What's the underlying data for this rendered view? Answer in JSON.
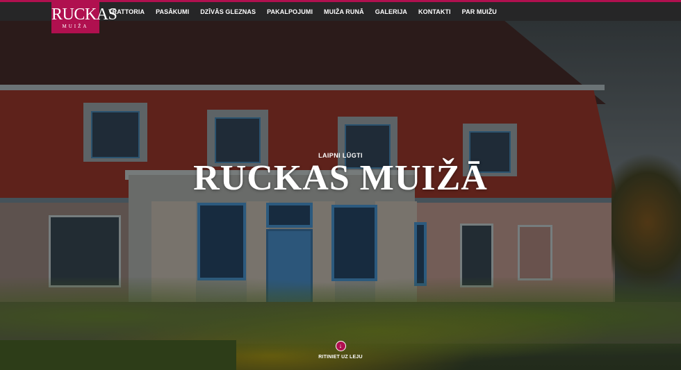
{
  "brand": {
    "name": "RUCKAS",
    "sub": "MUIŽA",
    "color": "#b0104f"
  },
  "nav": {
    "items": [
      {
        "label": "TRATTORIA"
      },
      {
        "label": "PASĀKUMI"
      },
      {
        "label": "DZĪVĀS GLEZNAS"
      },
      {
        "label": "PAKALPOJUMI"
      },
      {
        "label": "MUIŽA RUNĀ"
      },
      {
        "label": "GALERIJA"
      },
      {
        "label": "KONTAKTI"
      },
      {
        "label": "PAR MUIŽU"
      }
    ]
  },
  "hero": {
    "welcome": "LAIPNI LŪGTI",
    "title": "RUCKAS MUIŽĀ",
    "scroll_label": "RITINIET UZ LEJU",
    "scroll_icon": "arrow-down-circle-icon"
  }
}
